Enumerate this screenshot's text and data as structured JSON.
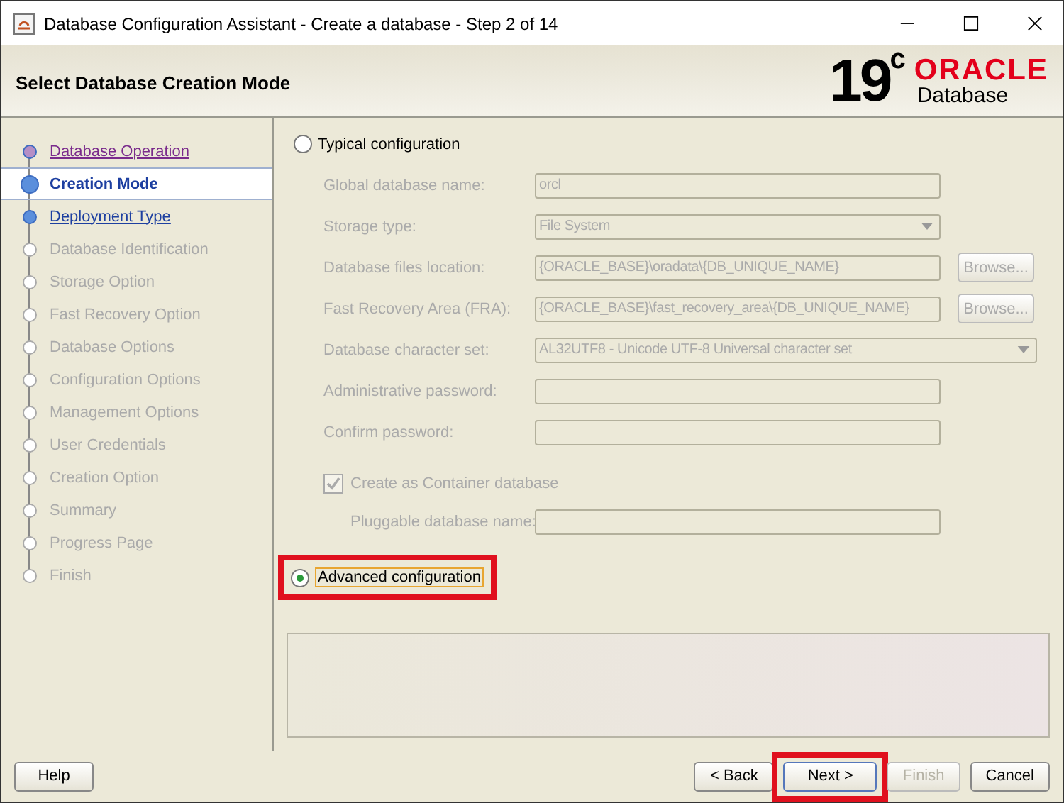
{
  "window": {
    "title": "Database Configuration Assistant - Create a database - Step 2 of 14"
  },
  "header": {
    "title": "Select Database Creation Mode",
    "version": "19",
    "version_suffix": "c",
    "brand": "ORACLE",
    "product": "Database"
  },
  "steps": [
    {
      "label": "Database Operation",
      "visited": true,
      "selected": false,
      "enabled": true
    },
    {
      "label": "Creation Mode",
      "visited": false,
      "selected": true,
      "enabled": true
    },
    {
      "label": "Deployment Type",
      "visited": false,
      "selected": false,
      "enabled": true
    },
    {
      "label": "Database Identification",
      "visited": false,
      "selected": false,
      "enabled": false
    },
    {
      "label": "Storage Option",
      "visited": false,
      "selected": false,
      "enabled": false
    },
    {
      "label": "Fast Recovery Option",
      "visited": false,
      "selected": false,
      "enabled": false
    },
    {
      "label": "Database Options",
      "visited": false,
      "selected": false,
      "enabled": false
    },
    {
      "label": "Configuration Options",
      "visited": false,
      "selected": false,
      "enabled": false
    },
    {
      "label": "Management Options",
      "visited": false,
      "selected": false,
      "enabled": false
    },
    {
      "label": "User Credentials",
      "visited": false,
      "selected": false,
      "enabled": false
    },
    {
      "label": "Creation Option",
      "visited": false,
      "selected": false,
      "enabled": false
    },
    {
      "label": "Summary",
      "visited": false,
      "selected": false,
      "enabled": false
    },
    {
      "label": "Progress Page",
      "visited": false,
      "selected": false,
      "enabled": false
    },
    {
      "label": "Finish",
      "visited": false,
      "selected": false,
      "enabled": false
    }
  ],
  "typical": {
    "label": "Typical configuration",
    "selected": false,
    "highlighted": false
  },
  "fields": [
    {
      "kind": "text",
      "label": "Global database name:",
      "value": "orcl",
      "disabled": true
    },
    {
      "kind": "select",
      "label": "Storage type:",
      "value": "File System",
      "disabled": true
    },
    {
      "kind": "browse",
      "label": "Database files location:",
      "value": "{ORACLE_BASE}\\oradata\\{DB_UNIQUE_NAME}",
      "button": "Browse...",
      "disabled": true
    },
    {
      "kind": "browse",
      "label": "Fast Recovery Area (FRA):",
      "value": "{ORACLE_BASE}\\fast_recovery_area\\{DB_UNIQUE_NAME}",
      "button": "Browse...",
      "disabled": true
    },
    {
      "kind": "wideselect",
      "label": "Database character set:",
      "value": "AL32UTF8 - Unicode UTF-8 Universal character set",
      "disabled": true
    },
    {
      "kind": "text",
      "label": "Administrative password:",
      "disabled": true
    },
    {
      "kind": "text",
      "label": "Confirm password:",
      "disabled": true
    }
  ],
  "container": {
    "label": "Create as Container database",
    "checked": true,
    "disabled": true
  },
  "pluggable": {
    "label": "Pluggable database name:",
    "disabled": true
  },
  "advanced": {
    "label": "Advanced configuration",
    "selected": true,
    "highlighted": true
  },
  "buttons": {
    "help": {
      "label": "Help"
    },
    "back": {
      "label": "< Back",
      "disabled": false,
      "highlighted": false
    },
    "next": {
      "label": "Next >",
      "disabled": false,
      "highlighted": true
    },
    "finish": {
      "label": "Finish",
      "disabled": true,
      "highlighted": false
    },
    "cancel": {
      "label": "Cancel"
    }
  }
}
